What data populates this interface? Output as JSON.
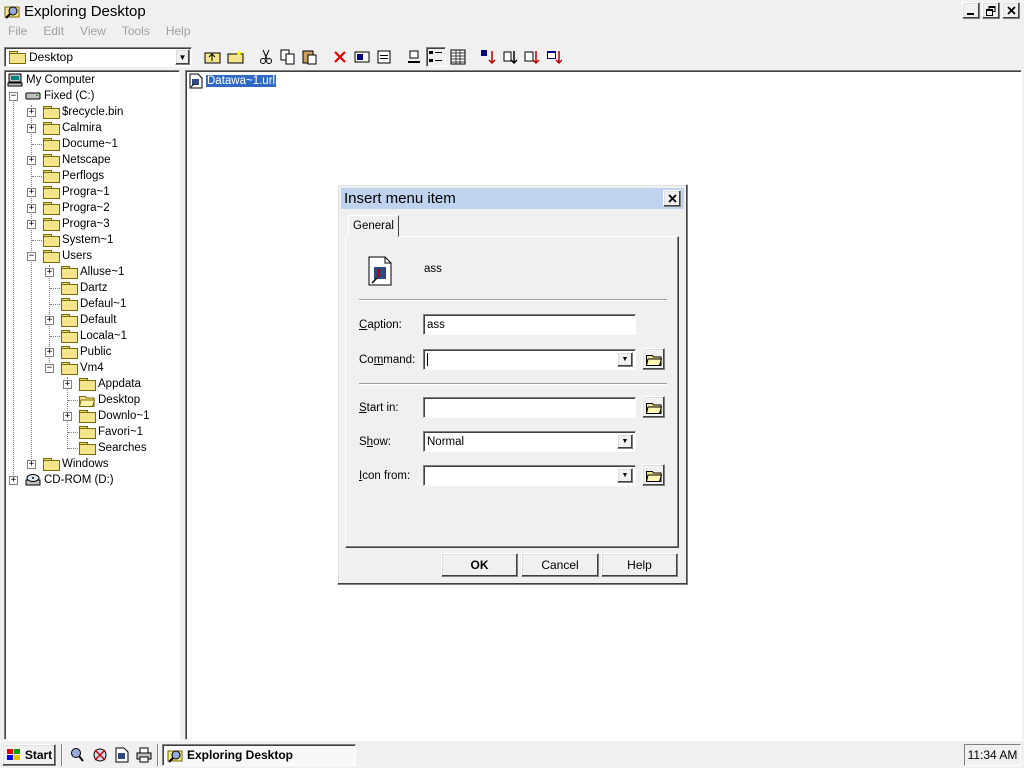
{
  "window": {
    "title": "Exploring Desktop"
  },
  "menu": [
    "File",
    "Edit",
    "View",
    "Tools",
    "Help"
  ],
  "address": {
    "value": "Desktop"
  },
  "tree": [
    {
      "label": "My Computer"
    },
    {
      "label": "Fixed (C:)"
    },
    {
      "label": "$recycle.bin"
    },
    {
      "label": "Calmira"
    },
    {
      "label": "Docume~1"
    },
    {
      "label": "Netscape"
    },
    {
      "label": "Perflogs"
    },
    {
      "label": "Progra~1"
    },
    {
      "label": "Progra~2"
    },
    {
      "label": "Progra~3"
    },
    {
      "label": "System~1"
    },
    {
      "label": "Users"
    },
    {
      "label": "Alluse~1"
    },
    {
      "label": "Dartz"
    },
    {
      "label": "Defaul~1"
    },
    {
      "label": "Default"
    },
    {
      "label": "Locala~1"
    },
    {
      "label": "Public"
    },
    {
      "label": "Vm4"
    },
    {
      "label": "Appdata"
    },
    {
      "label": "Desktop"
    },
    {
      "label": "Downlo~1"
    },
    {
      "label": "Favori~1"
    },
    {
      "label": "Searches"
    },
    {
      "label": "Windows"
    },
    {
      "label": "CD-ROM (D:)"
    }
  ],
  "files": [
    {
      "name": "Datawa~1.url",
      "selected": true
    }
  ],
  "dialog": {
    "title": "Insert menu item",
    "tab": "General",
    "item_name": "ass",
    "caption_label": "Caption:",
    "caption_value": "ass",
    "command_label": "Command:",
    "command_value": "",
    "startin_label": "Start in:",
    "startin_value": "",
    "show_label": "Show:",
    "show_value": "Normal",
    "iconfrom_label": "Icon from:",
    "iconfrom_value": "",
    "ok": "OK",
    "cancel": "Cancel",
    "help": "Help"
  },
  "taskbar": {
    "start": "Start",
    "task": "Exploring Desktop",
    "clock": "11:34 AM"
  },
  "colors": {
    "selection": "#316ac5",
    "dialog_title": "#bfd3ee",
    "face": "#f0f0f0"
  }
}
